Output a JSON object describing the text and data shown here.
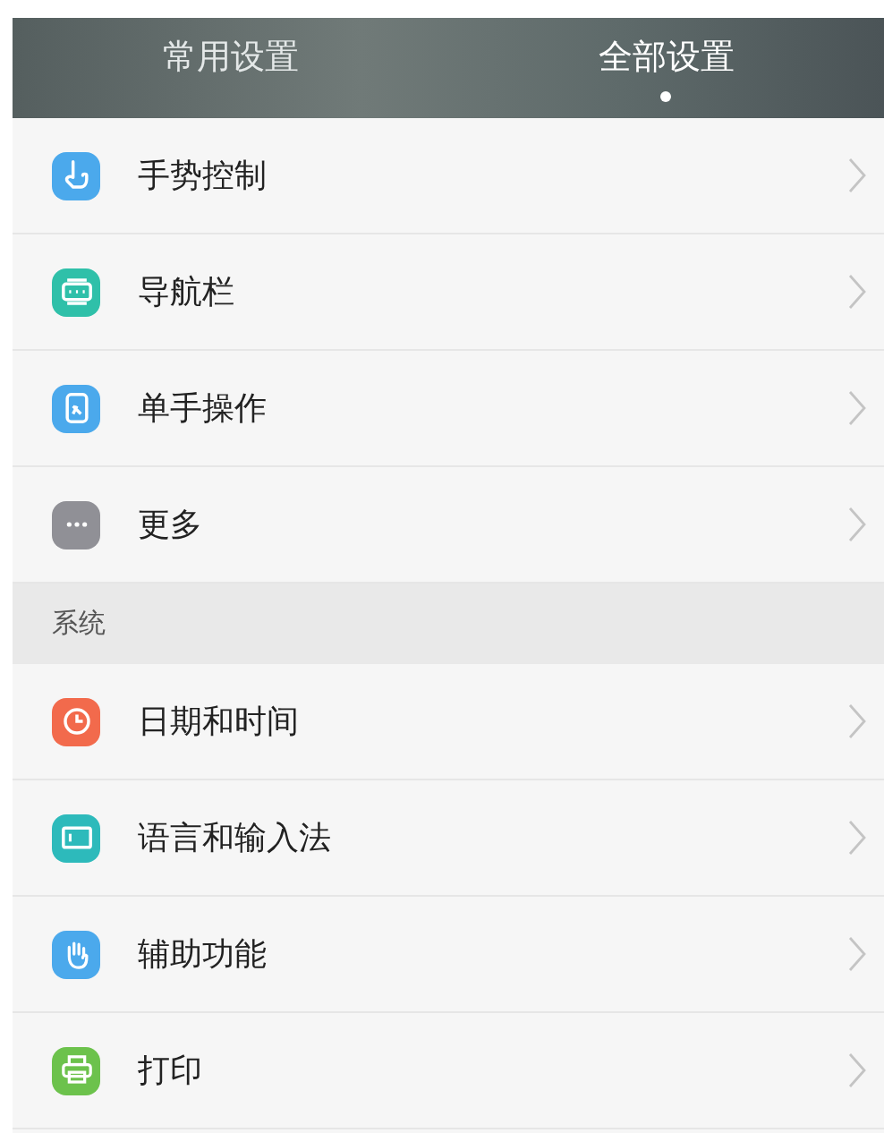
{
  "tabs": [
    {
      "label": "常用设置",
      "selected": false
    },
    {
      "label": "全部设置",
      "selected": true
    }
  ],
  "sections": [
    {
      "items": [
        {
          "label": "手势控制",
          "color": "#4ba9ec"
        },
        {
          "label": "导航栏",
          "color": "#2fc0a9"
        },
        {
          "label": "单手操作",
          "color": "#4ba9ec"
        },
        {
          "label": "更多",
          "color": "#909096"
        }
      ]
    },
    {
      "title": "系统",
      "items": [
        {
          "label": "日期和时间",
          "color": "#f26a4c"
        },
        {
          "label": "语言和输入法",
          "color": "#2dbabb"
        },
        {
          "label": "辅助功能",
          "color": "#4ba9ec"
        },
        {
          "label": "打印",
          "color": "#6cc24c"
        }
      ]
    }
  ]
}
